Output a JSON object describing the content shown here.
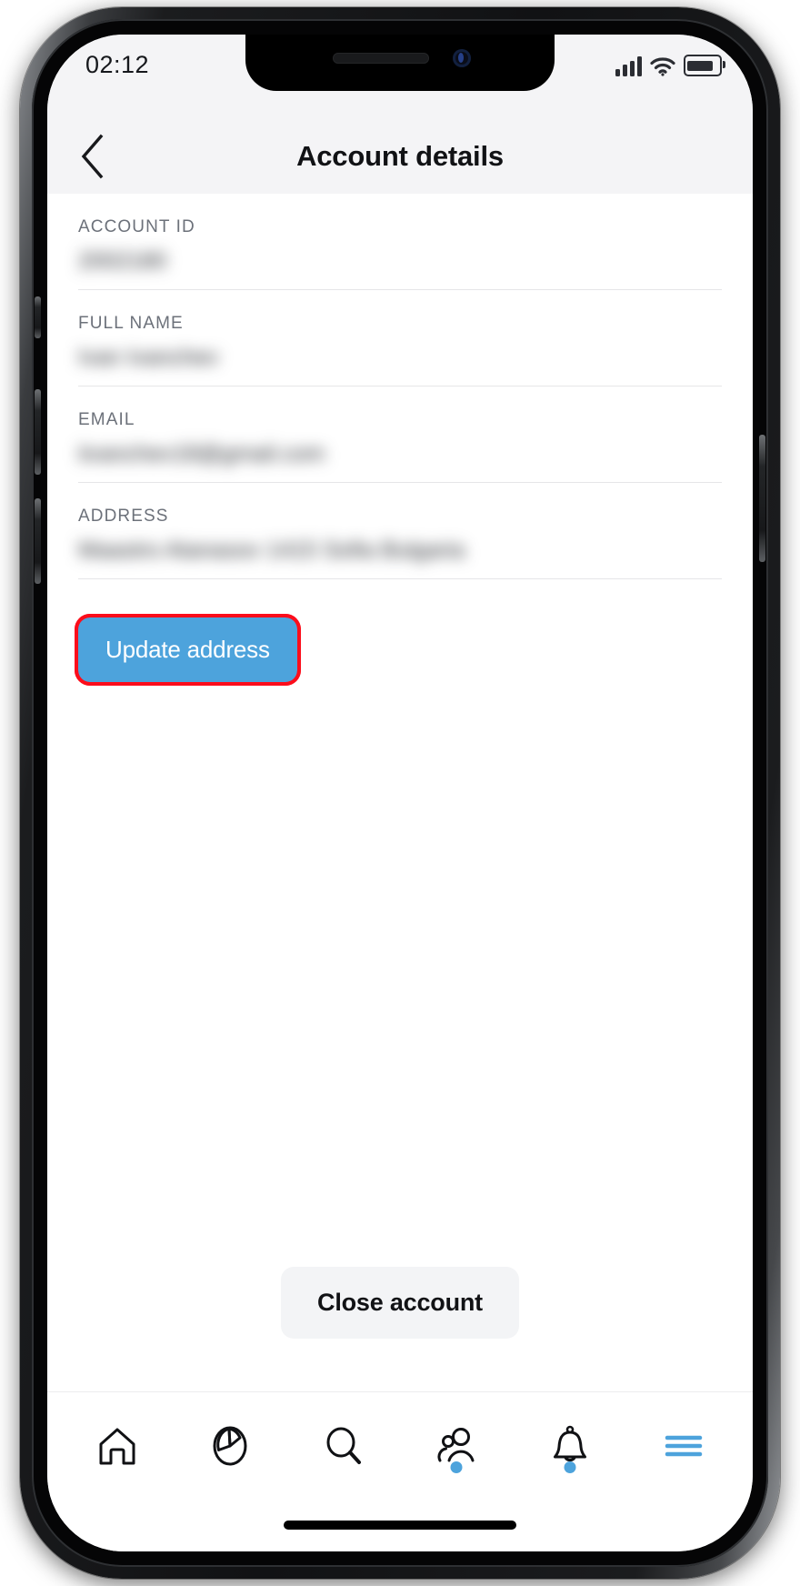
{
  "device": {
    "status_bar": {
      "time": "02:12",
      "icons": [
        "cellular-signal-icon",
        "wifi-icon",
        "battery-icon"
      ]
    },
    "home_indicator": "home-indicator"
  },
  "header": {
    "back_icon": "chevron-left-icon",
    "title": "Account details"
  },
  "form": {
    "fields": [
      {
        "label": "ACCOUNT ID",
        "value": "2002180",
        "redacted": true
      },
      {
        "label": "FULL NAME",
        "value": "Ivan Ivanchev",
        "redacted": true
      },
      {
        "label": "EMAIL",
        "value": "iivanchev18@gmail.com",
        "redacted": true
      },
      {
        "label": "ADDRESS",
        "value": "Maastro Atanasov 1415 Sofia Bulgaria",
        "redacted": true
      }
    ]
  },
  "actions": {
    "update_address_label": "Update address",
    "close_account_label": "Close account"
  },
  "tab_bar": {
    "items": [
      {
        "name": "home",
        "icon": "home-icon",
        "badge": false
      },
      {
        "name": "analytics",
        "icon": "pie-chart-icon",
        "badge": false
      },
      {
        "name": "search",
        "icon": "search-icon",
        "badge": false
      },
      {
        "name": "contacts",
        "icon": "people-icon",
        "badge": true
      },
      {
        "name": "notifications",
        "icon": "bell-icon",
        "badge": true
      },
      {
        "name": "menu",
        "icon": "hamburger-menu-icon",
        "badge": false
      }
    ]
  },
  "colors": {
    "accent_blue": "#4da3dc",
    "highlight_red": "#fc0d1b",
    "header_bg": "#f4f4f6",
    "secondary_button_bg": "#f3f4f6",
    "label_gray": "#6c717a"
  }
}
